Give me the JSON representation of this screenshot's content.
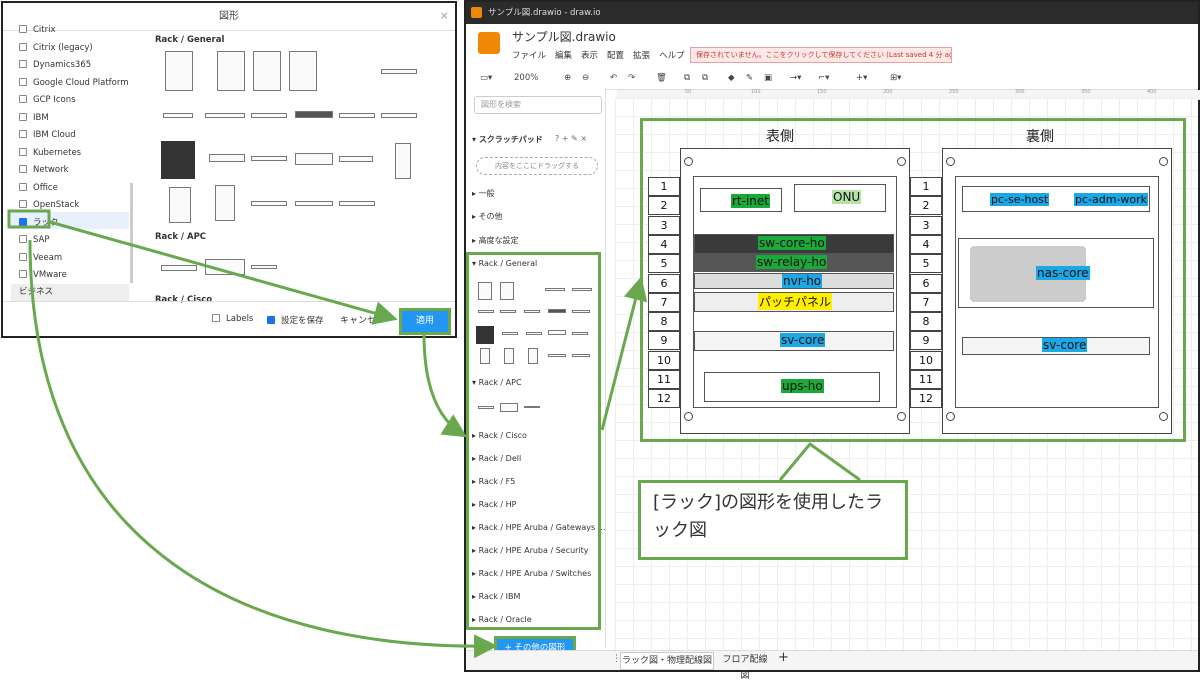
{
  "dialog": {
    "title": "図形",
    "close": "×",
    "libraries": [
      "Citrix",
      "Citrix (legacy)",
      "Dynamics365",
      "Google Cloud Platform",
      "GCP Icons",
      "IBM",
      "IBM Cloud",
      "Kubernetes",
      "Network",
      "Office",
      "OpenStack",
      "ラック",
      "SAP",
      "Veeam",
      "VMware"
    ],
    "checked_library": "ラック",
    "group_label": "ビジネス",
    "sections": [
      "Rack / General",
      "Rack / APC",
      "Rack / Cisco"
    ],
    "labels_option": "Labels",
    "save_option": "設定を保存",
    "cancel": "キャンセル",
    "apply": "適用"
  },
  "app": {
    "window_title": "サンプル図.drawio - draw.io",
    "doc_title": "サンプル図.drawio",
    "menus": [
      "ファイル",
      "編集",
      "表示",
      "配置",
      "拡張",
      "ヘルプ"
    ],
    "warning": "保存されていません。ここをクリックして保存してください (Last saved 4 分 ago)",
    "zoom": "200%",
    "search_placeholder": "図形を検索",
    "scratchpad": "スクラッチパッド",
    "scratch_drop": "内容をここにドラッグする",
    "sidebar_groups": [
      "一般",
      "その他",
      "高度な設定"
    ],
    "rack_general": "Rack / General",
    "rack_apc": "Rack / APC",
    "rack_more": [
      "Rack / Cisco",
      "Rack / Dell",
      "Rack / F5",
      "Rack / HP",
      "Rack / HPE Aruba / Gateways ...",
      "Rack / HPE Aruba / Security",
      "Rack / HPE Aruba / Switches",
      "Rack / IBM",
      "Rack / Oracle"
    ],
    "more_shapes": "+ その他の図形",
    "ruler": [
      "50",
      "100",
      "150",
      "200",
      "250",
      "300",
      "350",
      "400"
    ],
    "page_tabs": [
      "ラック図・物理配線図",
      "フロア配線図"
    ],
    "add_tab": "+"
  },
  "diagram": {
    "front_title": "表側",
    "back_title": "裏側",
    "units": [
      "1",
      "2",
      "3",
      "4",
      "5",
      "6",
      "7",
      "8",
      "9",
      "10",
      "11",
      "12"
    ],
    "front_labels": {
      "rt": "rt-inet",
      "onu": "ONU",
      "swcore": "sw-core-ho",
      "swrelay": "sw-relay-ho",
      "nvr": "nvr-ho",
      "patch": "パッチパネル",
      "svcore": "sv-core",
      "ups": "ups-ho"
    },
    "back_labels": {
      "pcse": "pc-se-host",
      "pcadm": "pc-adm-work",
      "nas": "nas-core",
      "svcore": "sv-core"
    }
  },
  "callout": "[ラック]の図形を使用したラック図",
  "colors": {
    "highlight": "#6aa84f",
    "button": "#2196f3",
    "label_green": "#1aaa3a",
    "label_blue": "#1ba8e5",
    "label_yellow": "#ffee00"
  }
}
